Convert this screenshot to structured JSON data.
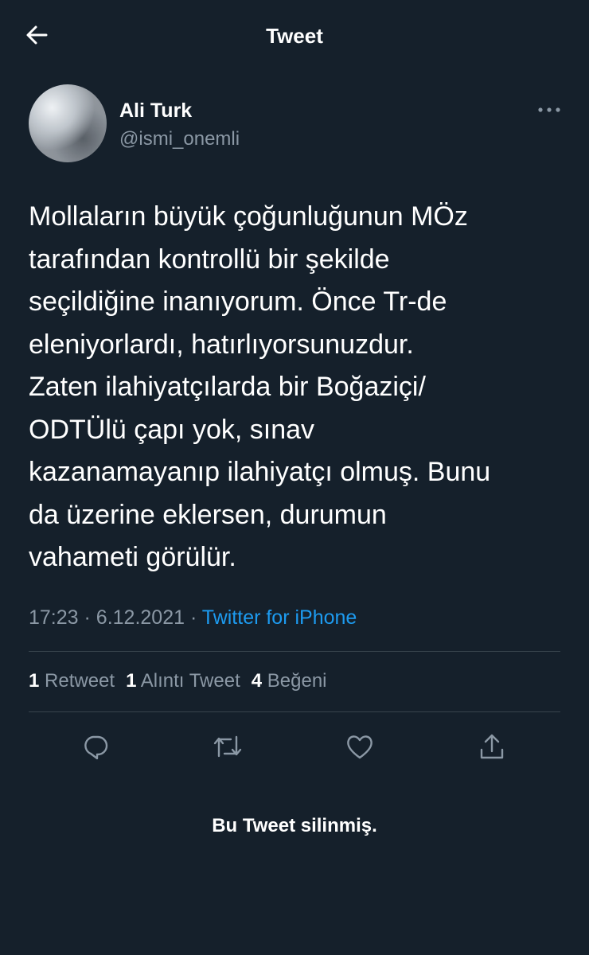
{
  "header": {
    "title": "Tweet",
    "back_icon": "arrow-left-icon"
  },
  "author": {
    "name": "Ali Turk",
    "handle": "@ismi_onemli"
  },
  "tweet": {
    "text": "Mollaların büyük çoğunluğunun MÖz\ntarafından kontrollü bir şekilde\nseçildiğine inanıyorum. Önce Tr-de\neleniyorlardı, hatırlıyorsunuzdur.\nZaten ilahiyatçılarda bir Boğaziçi/\nODTÜlü çapı yok, sınav\nkazanamayanıp ilahiyatçı olmuş. Bunu\nda üzerine eklersen, durumun\nvahameti görülür.",
    "time": "17:23",
    "date": "6.12.2021",
    "separator": "·",
    "source": "Twitter for iPhone"
  },
  "stats": {
    "retweets_count": "1",
    "retweets_label": "Retweet",
    "quotes_count": "1",
    "quotes_label": "Alıntı Tweet",
    "likes_count": "4",
    "likes_label": "Beğeni"
  },
  "actions": [
    "reply-icon",
    "retweet-icon",
    "like-icon",
    "share-icon"
  ],
  "notice": "Bu Tweet silinmiş.",
  "colors": {
    "background": "#15202b",
    "muted": "#8b98a5",
    "accent": "#1d9bf0",
    "divider": "#38444d"
  }
}
